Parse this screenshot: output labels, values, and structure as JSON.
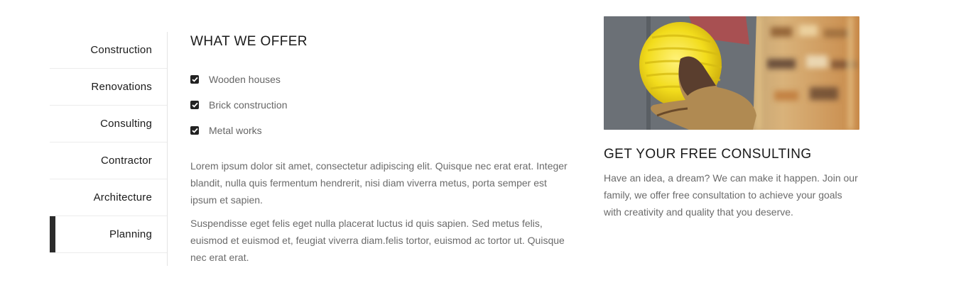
{
  "tabs": [
    {
      "label": "Construction",
      "active": false
    },
    {
      "label": "Renovations",
      "active": false
    },
    {
      "label": "Consulting",
      "active": false
    },
    {
      "label": "Contractor",
      "active": false
    },
    {
      "label": "Architecture",
      "active": false
    },
    {
      "label": "Planning",
      "active": true
    }
  ],
  "offer": {
    "title": "WHAT WE OFFER",
    "items": [
      "Wooden houses",
      "Brick construction",
      "Metal works"
    ],
    "paragraph1": "Lorem ipsum dolor sit amet, consectetur adipiscing elit. Quisque nec erat erat. Integer blandit, nulla quis fermentum hendrerit, nisi diam viverra metus, porta semper est ipsum et sapien.",
    "paragraph2": "Suspendisse eget felis eget nulla placerat luctus id quis sapien. Sed metus felis, euismod et euismod et, feugiat viverra diam.felis tortor, euismod ac tortor ut. Quisque nec erat erat."
  },
  "consulting": {
    "title": "GET YOUR FREE CONSULTING",
    "text": "Have an idea, a dream? We can make it happen. Join our family, we offer free consultation to achieve your goals with creativity and quality that you deserve."
  },
  "colors": {
    "active_tab_marker": "#2b2b2b",
    "checkbox": "#222222",
    "helmet": "#f2dc1c"
  }
}
